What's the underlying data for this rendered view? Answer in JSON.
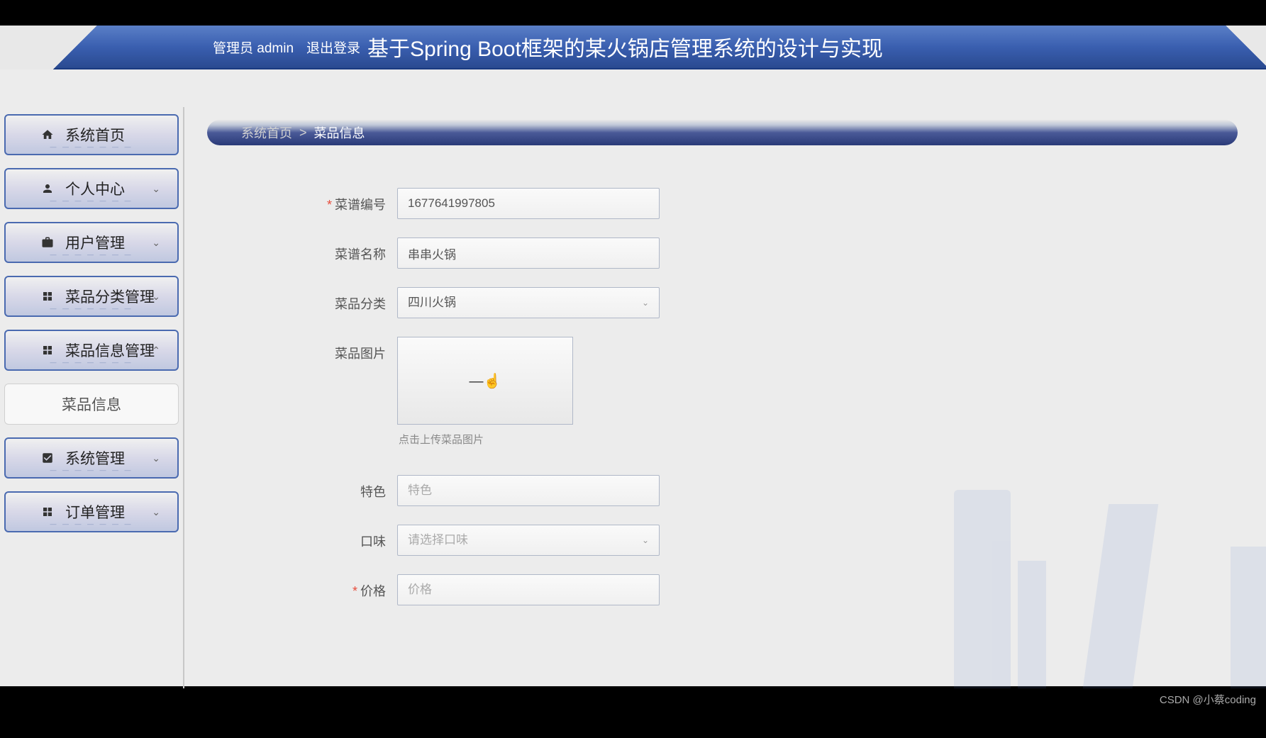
{
  "header": {
    "admin_label": "管理员 admin",
    "logout_label": "退出登录",
    "system_title": "基于Spring Boot框架的某火锅店管理系统的设计与实现"
  },
  "sidebar": {
    "items": [
      {
        "icon": "home",
        "label": "系统首页",
        "expandable": false
      },
      {
        "icon": "person",
        "label": "个人中心",
        "expandable": true,
        "expanded": false
      },
      {
        "icon": "briefcase",
        "label": "用户管理",
        "expandable": true,
        "expanded": false
      },
      {
        "icon": "grid",
        "label": "菜品分类管理",
        "expandable": true,
        "expanded": false
      },
      {
        "icon": "grid",
        "label": "菜品信息管理",
        "expandable": true,
        "expanded": true
      },
      {
        "icon": "",
        "label": "菜品信息",
        "is_sub": true
      },
      {
        "icon": "check-square",
        "label": "系统管理",
        "expandable": true,
        "expanded": false
      },
      {
        "icon": "grid",
        "label": "订单管理",
        "expandable": true,
        "expanded": false
      }
    ]
  },
  "breadcrumb": {
    "root": "系统首页",
    "current": "菜品信息"
  },
  "form": {
    "recipe_code_label": "菜谱编号",
    "recipe_code_value": "1677641997805",
    "recipe_name_label": "菜谱名称",
    "recipe_name_value": "串串火锅",
    "category_label": "菜品分类",
    "category_value": "四川火锅",
    "image_label": "菜品图片",
    "upload_hint": "点击上传菜品图片",
    "feature_label": "特色",
    "feature_placeholder": "特色",
    "taste_label": "口味",
    "taste_placeholder": "请选择口味",
    "price_label": "价格",
    "price_placeholder": "价格"
  },
  "watermark": "CSDN @小蔡coding"
}
